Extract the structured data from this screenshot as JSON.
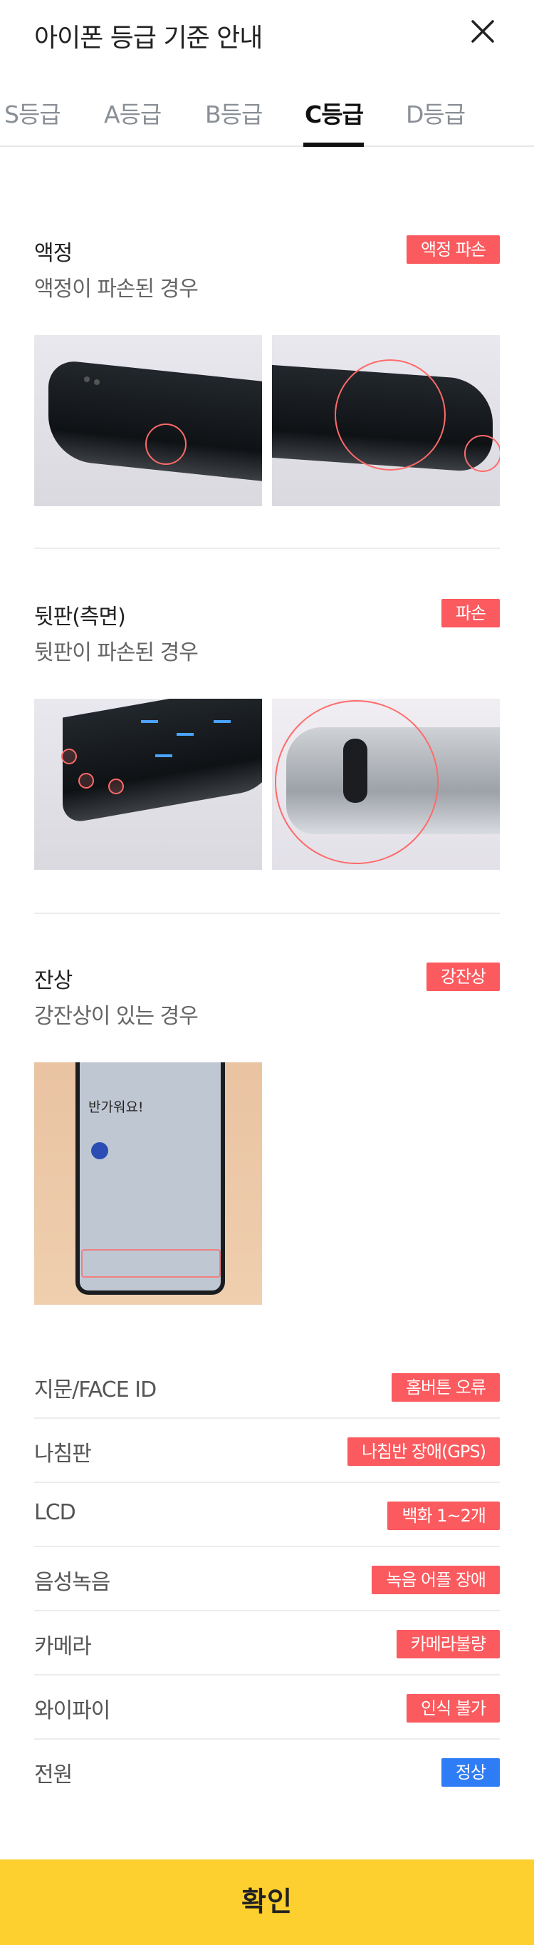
{
  "header": {
    "title": "아이폰 등급 기준 안내"
  },
  "tabs": [
    {
      "label": "S등급"
    },
    {
      "label": "A등급"
    },
    {
      "label": "B등급"
    },
    {
      "label": "C등급",
      "active": true
    },
    {
      "label": "D등급"
    }
  ],
  "sections": [
    {
      "title": "액정",
      "desc": "액정이 파손된 경우",
      "badge": "액정 파손"
    },
    {
      "title": "뒷판(측면)",
      "desc": "뒷판이 파손된 경우",
      "badge": "파손"
    },
    {
      "title": "잔상",
      "desc": "강잔상이 있는 경우",
      "badge": "강잔상",
      "screen_text": "반가워요!"
    }
  ],
  "specs": [
    {
      "label": "지문/FACE ID",
      "badge": "홈버튼 오류",
      "color": "#fb5a5e"
    },
    {
      "label": "나침판",
      "badge": "나침반 장애(GPS)",
      "color": "#fb5a5e"
    },
    {
      "label": "LCD",
      "badge": "백화 1~2개",
      "color": "#fb5a5e"
    },
    {
      "label": "음성녹음",
      "badge": "녹음 어플 장애",
      "color": "#fb5a5e"
    },
    {
      "label": "카메라",
      "badge": "카메라불량",
      "color": "#fb5a5e"
    },
    {
      "label": "와이파이",
      "badge": "인식 불가",
      "color": "#fb5a5e"
    },
    {
      "label": "전원",
      "badge": "정상",
      "color": "#2f7df6"
    }
  ],
  "footer": {
    "confirm_label": "확인"
  },
  "colors": {
    "accent_yellow": "#fdd030",
    "badge_red": "#fb5a5e",
    "badge_blue": "#2f7df6"
  }
}
